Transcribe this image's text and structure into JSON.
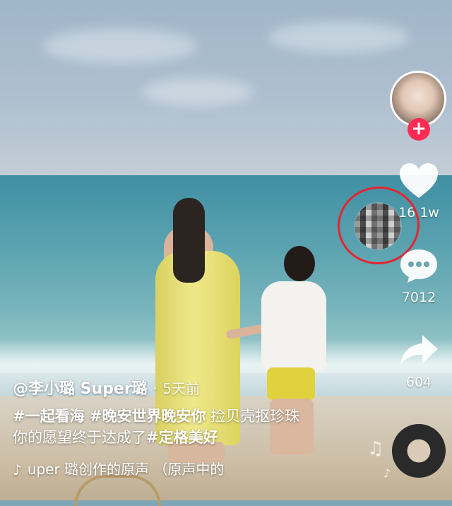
{
  "sidebar": {
    "like_count": "16.1w",
    "comment_count": "7012",
    "share_count": "604"
  },
  "caption": {
    "author": "@李小璐 Super璐",
    "separator": "·",
    "posted": "5天前",
    "line1_tags": "#一起看海 #晚安世界晚安你",
    "line1_text": " 捡贝壳抠珍珠",
    "line2_text": "你的愿望终于达成了",
    "line2_tag": "#定格美好",
    "music": "uper 璐创作的原声 （原声中的"
  },
  "colors": {
    "follow": "#fe2c55",
    "highlight_circle": "#e3262e"
  },
  "icons": [
    "plus-icon",
    "heart-icon",
    "comment-icon",
    "share-icon",
    "tiktok-note-icon",
    "music-note-icon"
  ]
}
